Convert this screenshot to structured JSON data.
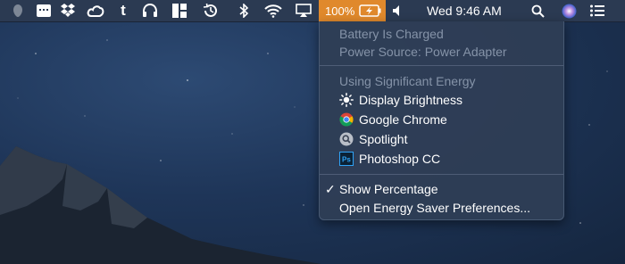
{
  "menubar": {
    "battery_percentage": "100%",
    "clock": "Wed 9:46 AM",
    "icons": [
      "avatar-icon",
      "calculator-icon",
      "dropbox-icon",
      "creative-cloud-icon",
      "tumblr-icon",
      "headphones-icon",
      "layout-icon",
      "time-machine-icon",
      "bluetooth-icon",
      "wifi-icon",
      "airplay-icon",
      "battery-icon",
      "volume-icon",
      "spotlight-search-icon",
      "siri-icon",
      "notification-center-icon"
    ]
  },
  "battery_menu": {
    "status": "Battery Is Charged",
    "power_source": "Power Source: Power Adapter",
    "energy_heading": "Using Significant Energy",
    "apps": [
      {
        "label": "Display Brightness",
        "icon": "brightness-icon"
      },
      {
        "label": "Google Chrome",
        "icon": "chrome-icon"
      },
      {
        "label": "Spotlight",
        "icon": "spotlight-icon"
      },
      {
        "label": "Photoshop CC",
        "icon": "photoshop-icon"
      }
    ],
    "show_percentage": "Show Percentage",
    "show_percentage_checked": true,
    "check_mark": "✓",
    "open_prefs": "Open Energy Saver Preferences..."
  },
  "colors": {
    "battery_highlight": "#e0892c",
    "menu_bg": "#2e3e56",
    "disabled_text": "#8593a8"
  }
}
